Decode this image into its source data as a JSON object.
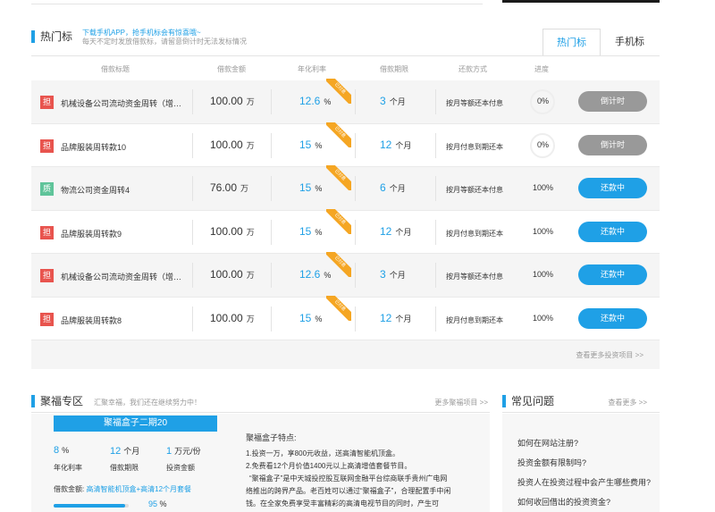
{
  "hot": {
    "title": "热门标",
    "sub_line1": "下载手机APP，抢手机标会有惊喜哦~",
    "sub_line2": "每天不定时发放借款标，请留意倒计时无法发标情况",
    "tabs": [
      "热门标",
      "手机标"
    ],
    "columns": [
      "借款标题",
      "借款金额",
      "年化利率",
      "借款期限",
      "还款方式",
      "进度"
    ],
    "ribbon_text": "已付息",
    "more_link": "查看更多投资项目 >>",
    "rows": [
      {
        "badge": "担",
        "badge_color": "#e8544e",
        "name": "机械设备公司流动资金周转（增…",
        "amount": "100.00",
        "amount_unit": "万",
        "rate": "12.6",
        "rate_unit": "%",
        "period": "3",
        "period_unit": "个月",
        "method": "按月等额还本付息",
        "progress": "0%",
        "button": "倒计时",
        "button_style": "gray"
      },
      {
        "badge": "担",
        "badge_color": "#e8544e",
        "name": "品牌服装周转款10",
        "amount": "100.00",
        "amount_unit": "万",
        "rate": "15",
        "rate_unit": "%",
        "period": "12",
        "period_unit": "个月",
        "method": "按月付息到期还本",
        "progress": "0%",
        "button": "倒计时",
        "button_style": "gray"
      },
      {
        "badge": "质",
        "badge_color": "#5fc49a",
        "name": "物流公司资金周转4",
        "amount": "76.00",
        "amount_unit": "万",
        "rate": "15",
        "rate_unit": "%",
        "period": "6",
        "period_unit": "个月",
        "method": "按月等额还本付息",
        "progress": "100%",
        "button": "还款中",
        "button_style": "blue"
      },
      {
        "badge": "担",
        "badge_color": "#e8544e",
        "name": "品牌服装周转款9",
        "amount": "100.00",
        "amount_unit": "万",
        "rate": "15",
        "rate_unit": "%",
        "period": "12",
        "period_unit": "个月",
        "method": "按月付息到期还本",
        "progress": "100%",
        "button": "还款中",
        "button_style": "blue"
      },
      {
        "badge": "担",
        "badge_color": "#e8544e",
        "name": "机械设备公司流动资金周转（增…",
        "amount": "100.00",
        "amount_unit": "万",
        "rate": "12.6",
        "rate_unit": "%",
        "period": "3",
        "period_unit": "个月",
        "method": "按月等额还本付息",
        "progress": "100%",
        "button": "还款中",
        "button_style": "blue"
      },
      {
        "badge": "担",
        "badge_color": "#e8544e",
        "name": "品牌服装周转款8",
        "amount": "100.00",
        "amount_unit": "万",
        "rate": "15",
        "rate_unit": "%",
        "period": "12",
        "period_unit": "个月",
        "method": "按月付息到期还本",
        "progress": "100%",
        "button": "还款中",
        "button_style": "blue"
      }
    ]
  },
  "jufu": {
    "title": "聚福专区",
    "sub": "汇聚幸福，我们还在继续努力中！",
    "more": "更多聚福项目 >>",
    "product": "聚福盒子二期20",
    "stats": [
      {
        "value": "8",
        "unit": "%",
        "label": "年化利率"
      },
      {
        "value": "12",
        "unit": "个月",
        "label": "借款期限"
      },
      {
        "value": "1",
        "unit": "万元/份",
        "label": "投资金额"
      }
    ],
    "loan_label": "借款金额:",
    "loan_value": "高清智能机顶盒+高清12个月套餐",
    "progress_value": 95,
    "progress_text": "95",
    "progress_unit": "%",
    "feature_title": "聚福盒子特点:",
    "features": [
      "1.投资一万，享800元收益，送高清智能机顶盒。",
      "2.免费看12个月价值1400元以上高清增值套餐节目。",
      "“聚福盒子”是中天城投控股互联网金融平台综商联手贵州广电网络推出的跨界产品。老百姓可以通过“聚福盒子”，合理配置手中闲钱。在全家免费享受丰富精彩的高清电视节目的同时，产生可靠、可观的理财收益。"
    ]
  },
  "faq": {
    "title": "常见问题",
    "more": "查看更多 >>",
    "items": [
      "如何在网站注册?",
      "投资金额有限制吗?",
      "投资人在投资过程中会产生哪些费用?",
      "如何收回借出的投资资金?"
    ]
  }
}
